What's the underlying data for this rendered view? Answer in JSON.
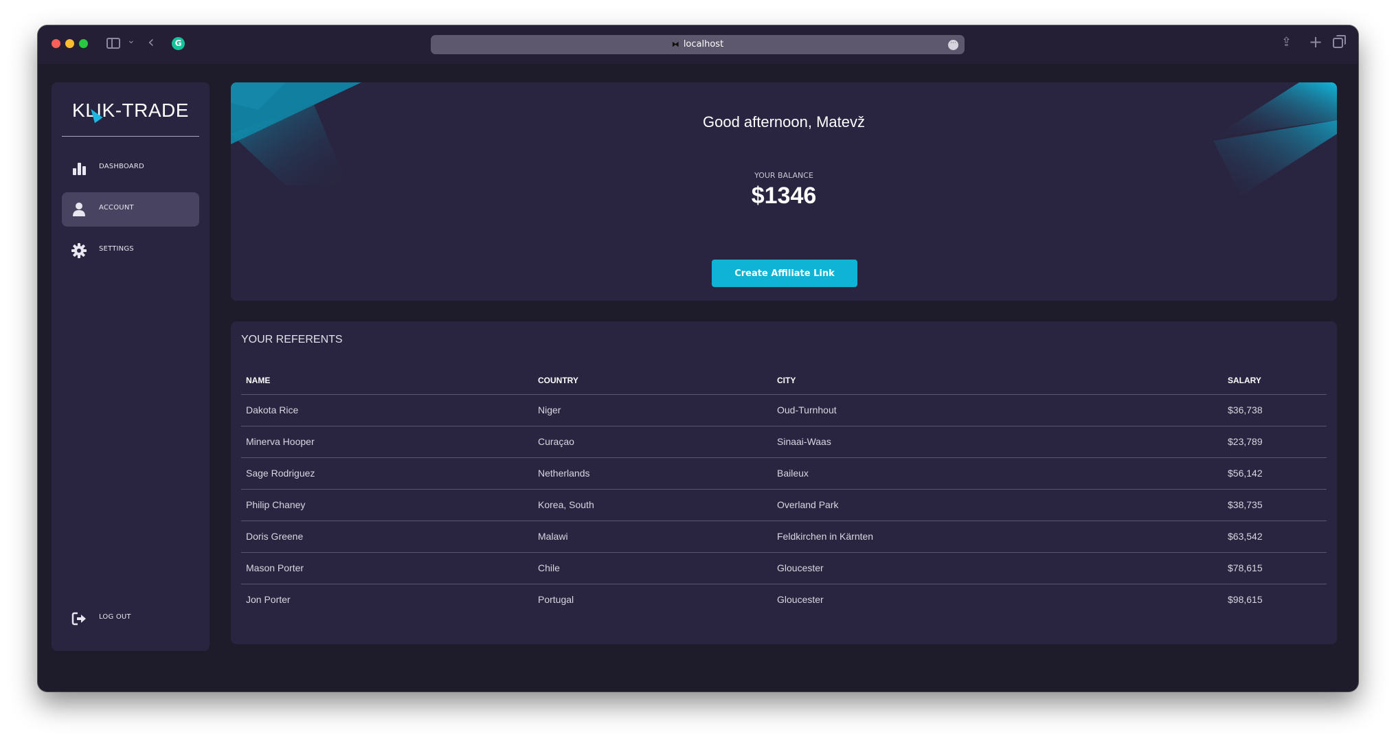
{
  "browser": {
    "url": "localhost"
  },
  "sidebar": {
    "logo": "KLIK-TRADE",
    "items": [
      {
        "label": "DASHBOARD",
        "icon": "bar-chart-icon"
      },
      {
        "label": "ACCOUNT",
        "icon": "user-icon",
        "active": true
      },
      {
        "label": "SETTINGS",
        "icon": "gear-icon"
      }
    ],
    "logout_label": "LOG OUT"
  },
  "hero": {
    "greeting": "Good afternoon, Matevž",
    "balance_label": "YOUR BALANCE",
    "balance": "$1346",
    "button_label": "Create Affiliate Link"
  },
  "referents": {
    "title": "YOUR REFERENTS",
    "columns": [
      "NAME",
      "COUNTRY",
      "CITY",
      "SALARY"
    ],
    "rows": [
      [
        "Dakota Rice",
        "Niger",
        "Oud-Turnhout",
        "$36,738"
      ],
      [
        "Minerva Hooper",
        "Curaçao",
        "Sinaai-Waas",
        "$23,789"
      ],
      [
        "Sage Rodriguez",
        "Netherlands",
        "Baileux",
        "$56,142"
      ],
      [
        "Philip Chaney",
        "Korea, South",
        "Overland Park",
        "$38,735"
      ],
      [
        "Doris Greene",
        "Malawi",
        "Feldkirchen in Kärnten",
        "$63,542"
      ],
      [
        "Mason Porter",
        "Chile",
        "Gloucester",
        "$78,615"
      ],
      [
        "Jon Porter",
        "Portugal",
        "Gloucester",
        "$98,615"
      ]
    ]
  },
  "colors": {
    "accent": "#0fb3d6",
    "background": "#1e1b2b",
    "card": "#292540",
    "active_nav": "#474360"
  }
}
